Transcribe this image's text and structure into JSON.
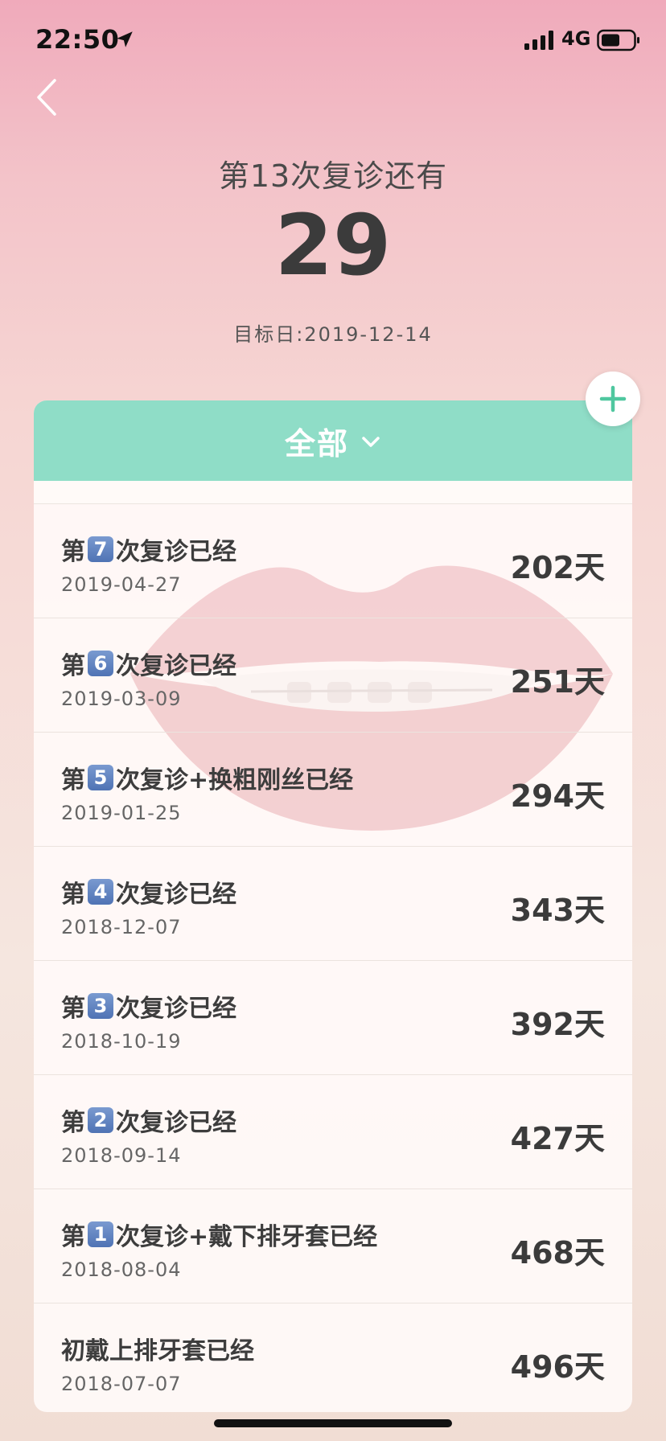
{
  "status_bar": {
    "time": "22:50",
    "network": "4G"
  },
  "hero": {
    "title": "第13次复诊还有",
    "count": "29",
    "target": "目标日:2019-12-14"
  },
  "filter": {
    "label": "全部"
  },
  "items": [
    {
      "prefix": "第",
      "badge": "7",
      "suffix": "次复诊已经",
      "date": "2019-04-27",
      "days": "202天"
    },
    {
      "prefix": "第",
      "badge": "6",
      "suffix": "次复诊已经",
      "date": "2019-03-09",
      "days": "251天"
    },
    {
      "prefix": "第",
      "badge": "5",
      "suffix": "次复诊+换粗刚丝已经",
      "date": "2019-01-25",
      "days": "294天"
    },
    {
      "prefix": "第",
      "badge": "4",
      "suffix": "次复诊已经",
      "date": "2018-12-07",
      "days": "343天"
    },
    {
      "prefix": "第",
      "badge": "3",
      "suffix": "次复诊已经",
      "date": "2018-10-19",
      "days": "392天"
    },
    {
      "prefix": "第",
      "badge": "2",
      "suffix": "次复诊已经",
      "date": "2018-09-14",
      "days": "427天"
    },
    {
      "prefix": "第",
      "badge": "1",
      "suffix": "次复诊+戴下排牙套已经",
      "date": "2018-08-04",
      "days": "468天"
    },
    {
      "prefix": "初戴上排牙套已经",
      "badge": "",
      "suffix": "",
      "date": "2018-07-07",
      "days": "496天"
    }
  ],
  "colors": {
    "accent": "#8fddc7",
    "badge": "#5a7dbd"
  },
  "icons": [
    "location-arrow-icon",
    "signal-icon",
    "battery-icon",
    "back-chevron-icon",
    "plus-icon",
    "chevron-down-icon"
  ]
}
